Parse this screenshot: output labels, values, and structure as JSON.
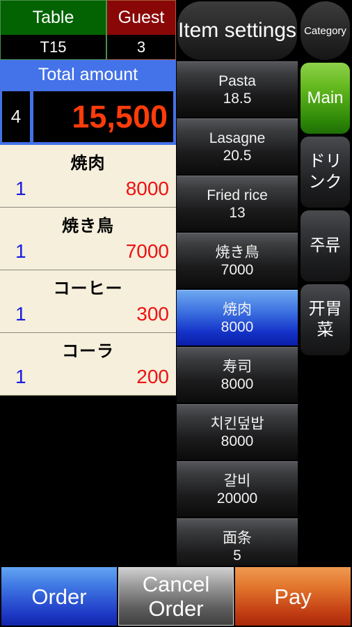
{
  "order_header": {
    "table_label": "Table",
    "table_value": "T15",
    "guest_label": "Guest",
    "guest_value": "3",
    "total_label": "Total amount",
    "total_count": "4",
    "total_amount": "15,500",
    "colors": {
      "table_header": "#036303",
      "guest_header": "#8a0707",
      "total_header": "#4472e8",
      "total_amount_text": "#ff3c0a"
    }
  },
  "order_list": {
    "items": [
      {
        "name": "焼肉",
        "qty": "1",
        "price": "8000"
      },
      {
        "name": "焼き鳥",
        "qty": "1",
        "price": "7000"
      },
      {
        "name": "コーヒー",
        "qty": "1",
        "price": "300"
      },
      {
        "name": "コーラ",
        "qty": "1",
        "price": "200"
      }
    ]
  },
  "menu_panel": {
    "header": "Item settings",
    "items": [
      {
        "name": "Pasta",
        "price": "18.5",
        "selected": false
      },
      {
        "name": "Lasagne",
        "price": "20.5",
        "selected": false
      },
      {
        "name": "Fried rice",
        "price": "13",
        "selected": false
      },
      {
        "name": "焼き鳥",
        "price": "7000",
        "selected": false
      },
      {
        "name": "焼肉",
        "price": "8000",
        "selected": true
      },
      {
        "name": "寿司",
        "price": "8000",
        "selected": false
      },
      {
        "name": "치킨덮밥",
        "price": "8000",
        "selected": false
      },
      {
        "name": "갈비",
        "price": "20000",
        "selected": false
      },
      {
        "name": "面条",
        "price": "5",
        "selected": false
      }
    ]
  },
  "category_panel": {
    "header": "Category",
    "items": [
      {
        "label": "Main",
        "active": true
      },
      {
        "label": "ドリンク",
        "active": false
      },
      {
        "label": "주류",
        "active": false
      },
      {
        "label": "开胃菜",
        "active": false
      }
    ],
    "active_color": "#2f8a08"
  },
  "action_bar": {
    "order_label": "Order",
    "cancel_label": "Cancel Order",
    "pay_label": "Pay",
    "colors": {
      "order": "#1e39c6",
      "cancel": "#5e5e5e",
      "pay": "#c03a12"
    }
  }
}
